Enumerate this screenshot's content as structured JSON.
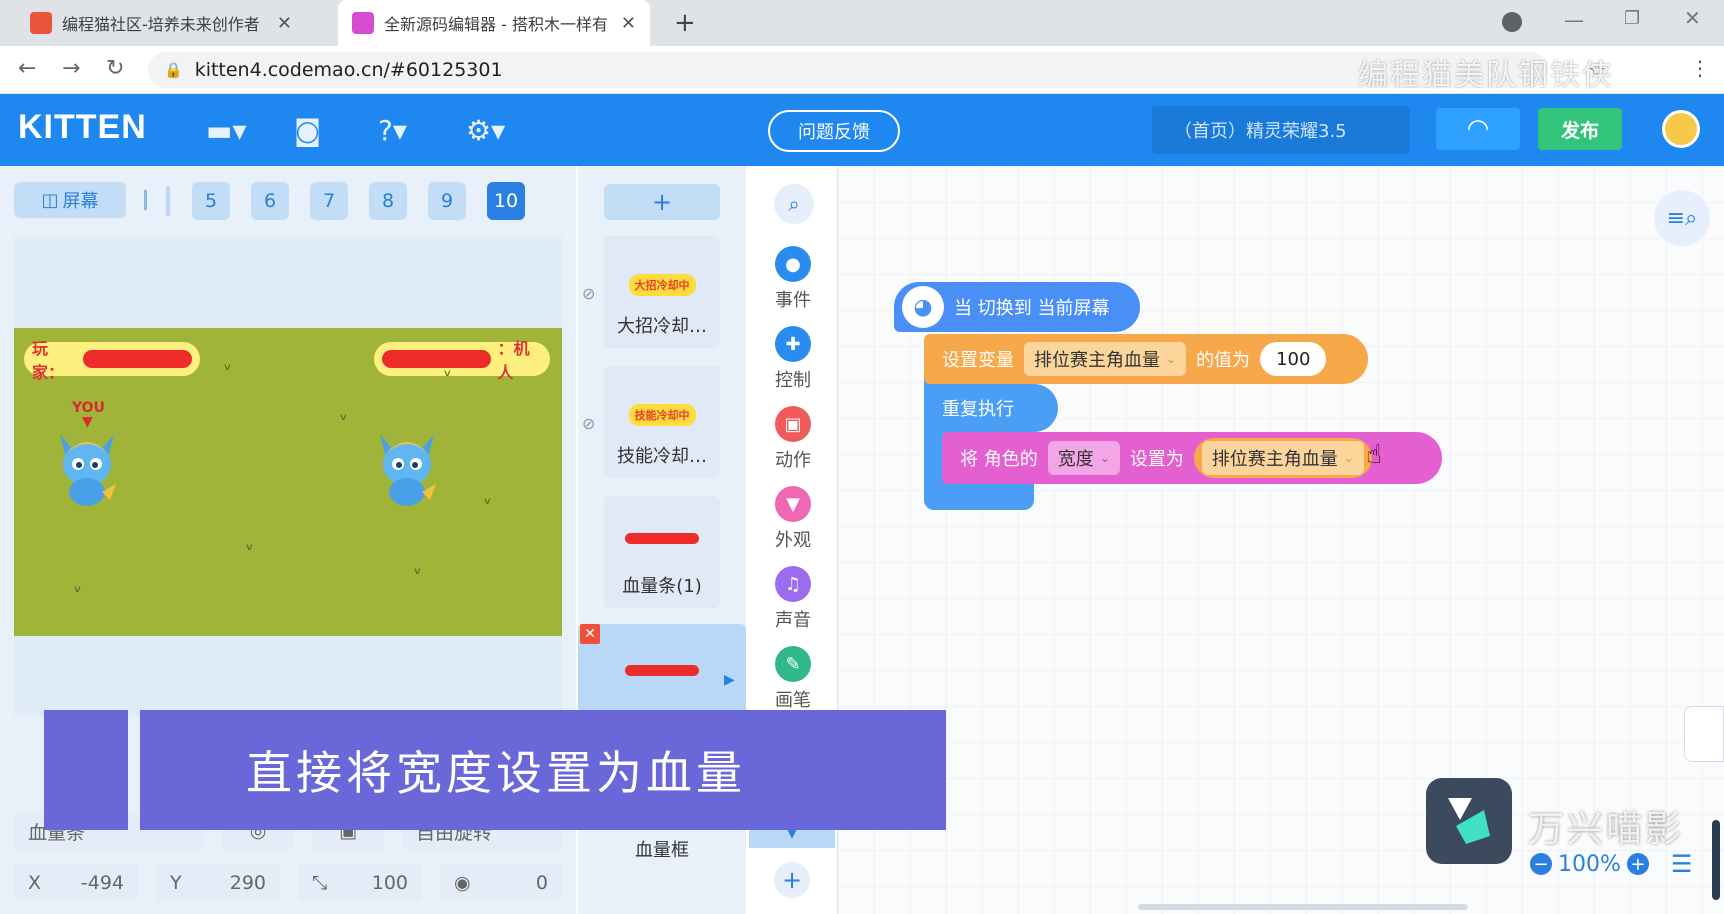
{
  "browser": {
    "tabs": [
      {
        "title": "编程猫社区-培养未来创作者",
        "close": "✕"
      },
      {
        "title": "全新源码编辑器 - 搭积木一样有",
        "close": "✕"
      }
    ],
    "new_tab": "+",
    "url": "kitten4.codemao.cn/#60125301",
    "watermark": "编程猫美队钢铁侠"
  },
  "header": {
    "logo": "KITTEN",
    "feedback_label": "问题反馈",
    "project_name": "（首页）精灵荣耀3.5",
    "publish_label": "发布"
  },
  "stage": {
    "screen_label": "屏幕",
    "screen_numbers": [
      "5",
      "6",
      "7",
      "8",
      "9",
      "10"
    ],
    "selected_screen": "10",
    "player_label": "玩家：",
    "robot_label": "：机人",
    "you_label": "YOU",
    "sprite_name_field": "血量条",
    "rotate_mode": "自由旋转",
    "x_label": "X",
    "x_value": "-494",
    "y_label": "Y",
    "y_value": "290",
    "size_value": "100",
    "rotation_value": "0"
  },
  "sprites": {
    "add_label": "+",
    "items": [
      {
        "name": "大招冷却…",
        "badge": "大招冷却中"
      },
      {
        "name": "技能冷却…",
        "badge": "技能冷却中"
      },
      {
        "name": "血量条(1)"
      },
      {
        "name": ""
      },
      {
        "name": "血量框"
      }
    ]
  },
  "categories": [
    {
      "label": "事件",
      "color": "#2a8cf0",
      "icon": "toggle-icon"
    },
    {
      "label": "控制",
      "color": "#2a8cf0",
      "icon": "gamepad-icon"
    },
    {
      "label": "动作",
      "color": "#f05a5a",
      "icon": "robot-icon"
    },
    {
      "label": "外观",
      "color": "#f067b4",
      "icon": "shirt-icon"
    },
    {
      "label": "声音",
      "color": "#9a6cf0",
      "icon": "music-icon"
    },
    {
      "label": "画笔",
      "color": "#2fb88a",
      "icon": "brush-icon"
    }
  ],
  "blocks": {
    "hat_text": "当 切换到 当前屏幕",
    "set_var_prefix": "设置变量",
    "set_var_name": "排位赛主角血量",
    "set_var_mid": "的值为",
    "set_var_value": "100",
    "repeat_label": "重复执行",
    "set_prop_prefix": "将 角色的",
    "set_prop_name": "宽度",
    "set_prop_mid": "设置为",
    "set_prop_value": "排位赛主角血量"
  },
  "overlay": {
    "caption": "直接将宽度设置为血量",
    "filmora_text": "万兴喵影",
    "zoom": "100%"
  },
  "colors": {
    "header_blue": "#1f88f0",
    "event_block": "#4a8ff5",
    "variable_block": "#f7a84a",
    "control_block": "#4a9ff5",
    "appearance_block": "#e45fd0"
  }
}
